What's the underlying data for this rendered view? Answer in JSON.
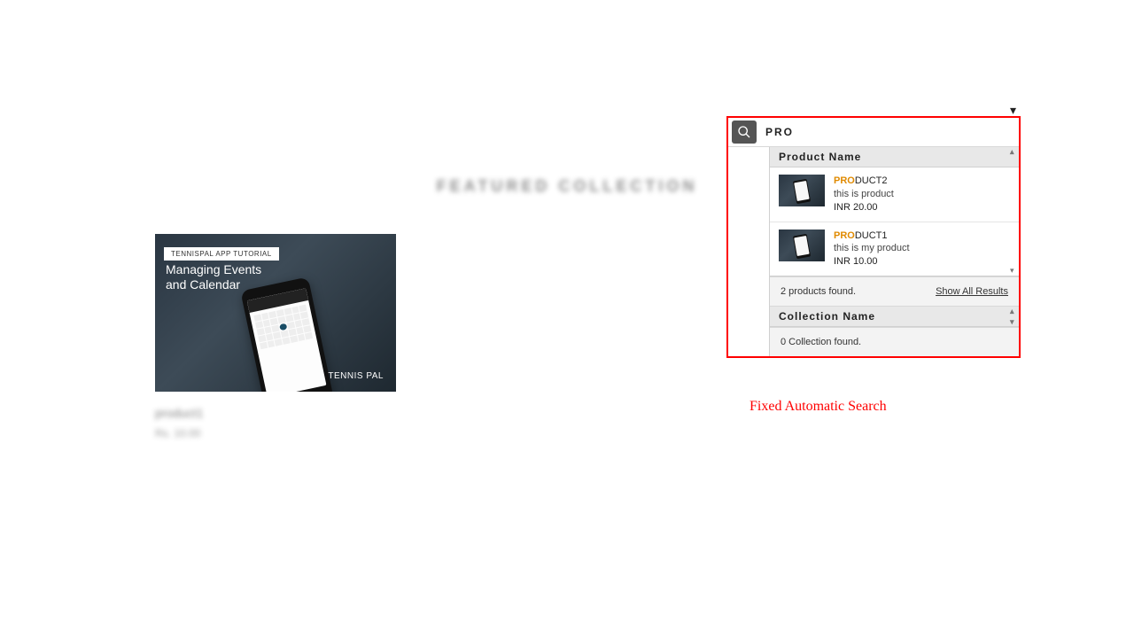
{
  "background": {
    "heading": "FEATURED COLLECTION",
    "product_name": "product1",
    "product_price": "Rs. 10.00",
    "thumb_label": "TENNISPAL APP TUTORIAL",
    "thumb_title_line1": "Managing Events",
    "thumb_title_line2": "and Calendar",
    "thumb_logo": "TENNIS PAL"
  },
  "search": {
    "query": "PRO",
    "product_section": "Product Name",
    "collection_section": "Collection Name",
    "products_found": "2 products found.",
    "collections_found": "0 Collection found.",
    "show_all": "Show All Results",
    "results": [
      {
        "match": "PRO",
        "rest": "DUCT2",
        "desc": "this is product",
        "price": "INR 20.00"
      },
      {
        "match": "PRO",
        "rest": "DUCT1",
        "desc": "this is my product",
        "price": "INR 10.00"
      }
    ]
  },
  "caption": "Fixed Automatic Search"
}
